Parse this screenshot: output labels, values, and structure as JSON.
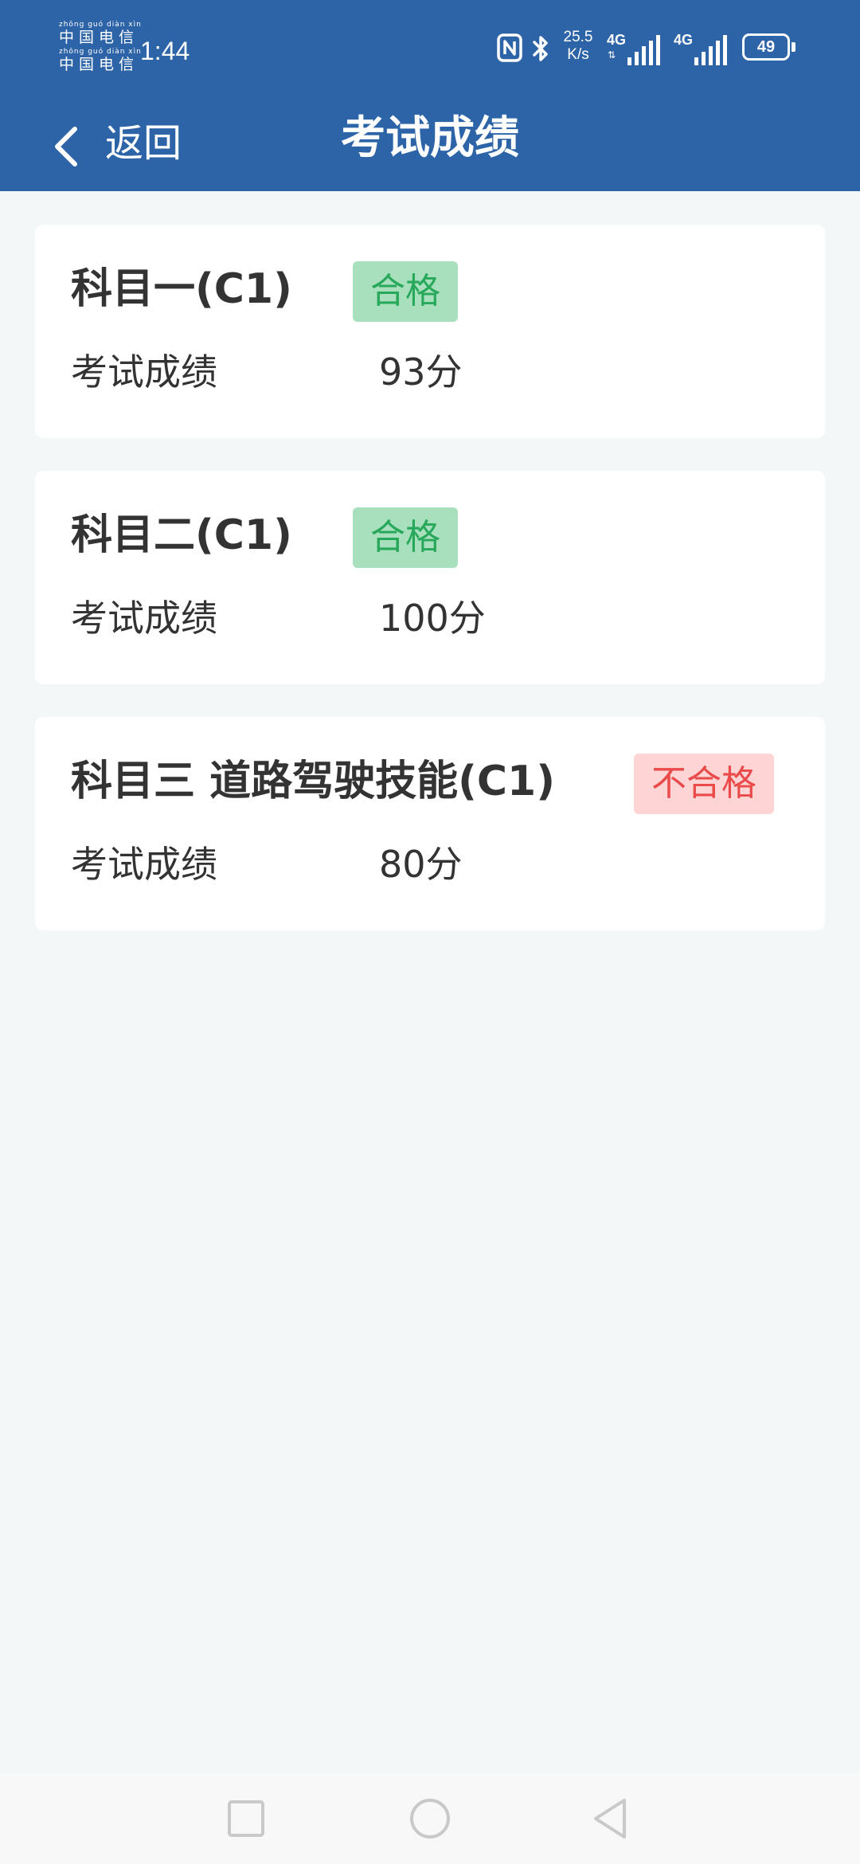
{
  "status_bar": {
    "carrier_pinyin": "zhōng guó diàn xìn",
    "carrier_name": "中国电信",
    "time": "1:44",
    "net_speed_value": "25.5",
    "net_speed_unit": "K/s",
    "signal_1_label": "4G",
    "signal_2_label": "4G",
    "battery": "49",
    "icons": [
      "nfc-icon",
      "bluetooth-icon",
      "signal-icon",
      "battery-icon"
    ]
  },
  "header": {
    "back_label": "返回",
    "title": "考试成绩"
  },
  "results": [
    {
      "subject": "科目一(C1)",
      "status": "合格",
      "passed": true,
      "score_label": "考试成绩",
      "score": "93分"
    },
    {
      "subject": "科目二(C1)",
      "status": "合格",
      "passed": true,
      "score_label": "考试成绩",
      "score": "100分"
    },
    {
      "subject": "科目三 道路驾驶技能(C1)",
      "status": "不合格",
      "passed": false,
      "score_label": "考试成绩",
      "score": "80分"
    }
  ],
  "nav_bar": {
    "icons": [
      "recent-apps-icon",
      "home-icon",
      "back-triangle-icon"
    ]
  },
  "colors": {
    "header_bg": "#2d64a8",
    "page_bg": "#f4f7f8",
    "pass_badge_bg": "#a8e0bd",
    "pass_text": "#27a85a",
    "fail_badge_bg": "#ffd4d4",
    "fail_text": "#ea4a4a"
  }
}
